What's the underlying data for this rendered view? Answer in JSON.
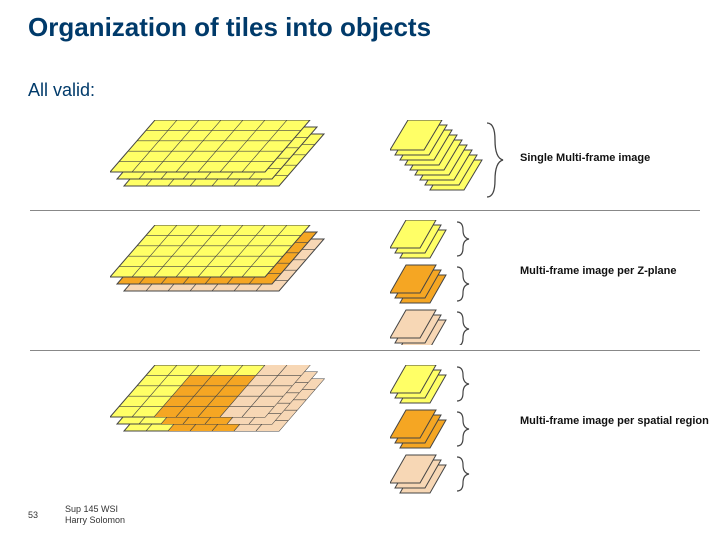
{
  "title": "Organization of tiles into objects",
  "subtitle": "All valid:",
  "rows": [
    {
      "label": "Single Multi-frame image"
    },
    {
      "label": "Multi-frame image per Z-plane"
    },
    {
      "label": "Multi-frame image per spatial region"
    }
  ],
  "footer": {
    "page": "53",
    "text1": "Sup 145 WSI",
    "text2": "Harry Solomon"
  },
  "colors": {
    "yellow": "#ffff66",
    "orange": "#f5a623",
    "peach": "#f7d7b5",
    "stroke": "#444"
  }
}
